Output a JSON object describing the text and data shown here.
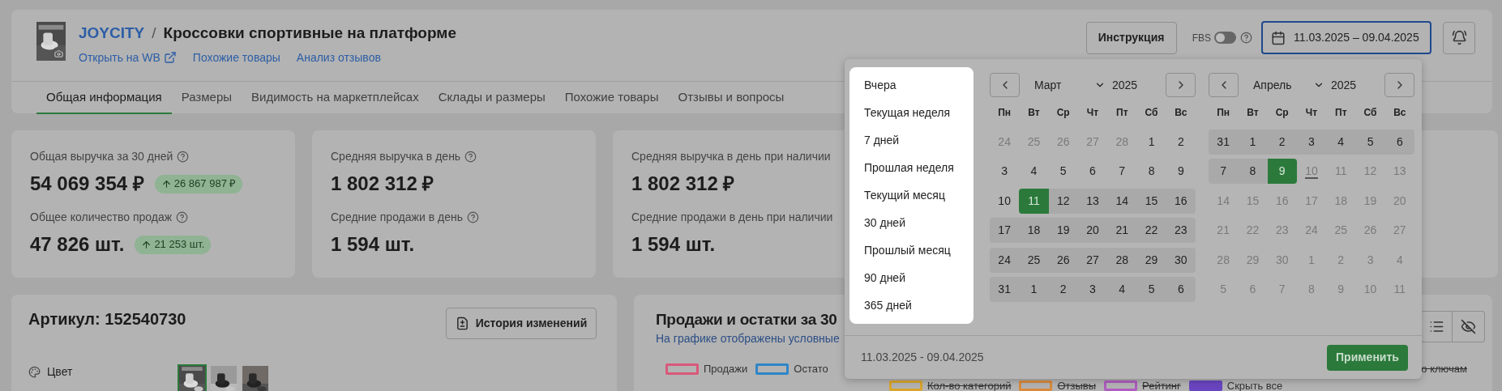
{
  "header": {
    "brand": "JOYCITY",
    "separator": "/",
    "title": "Кроссовки спортивные на платформе",
    "links": [
      {
        "label": "Открыть на WB",
        "external": true
      },
      {
        "label": "Похожие товары",
        "external": false
      },
      {
        "label": "Анализ отзывов",
        "external": false
      }
    ],
    "instruction_button": "Инструкция",
    "fbs": {
      "label": "FBS",
      "on": false
    },
    "date_range": "11.03.2025 – 09.04.2025"
  },
  "tabs": [
    {
      "label": "Общая информация",
      "selected": true
    },
    {
      "label": "Размеры",
      "selected": false
    },
    {
      "label": "Видимость на маркетплейсах",
      "selected": false
    },
    {
      "label": "Склады и размеры",
      "selected": false
    },
    {
      "label": "Похожие товары",
      "selected": false
    },
    {
      "label": "Отзывы и вопросы",
      "selected": false
    }
  ],
  "stats": [
    {
      "rows": [
        {
          "label": "Общая выручка за 30 дней",
          "help": true,
          "value": "54 069 354 ₽",
          "delta": "26 867 987 ₽"
        },
        {
          "label": "Общее количество продаж",
          "help": true,
          "value": "47 826 шт.",
          "delta": "21 253 шт."
        }
      ]
    },
    {
      "rows": [
        {
          "label": "Средняя выручка в день",
          "help": true,
          "value": "1 802 312 ₽"
        },
        {
          "label": "Средние продажи в день",
          "help": true,
          "value": "1 594 шт."
        }
      ]
    },
    {
      "rows": [
        {
          "label": "Средняя выручка в день при наличии",
          "help": false,
          "value": "1 802 312 ₽"
        },
        {
          "label": "Средние продажи в день при наличии",
          "help": false,
          "value": "1 594 шт."
        }
      ]
    }
  ],
  "product": {
    "article": "Артикул: 152540730",
    "history_button": "История изменений",
    "color_label": "Цвет",
    "thumbnails": [
      {
        "kind": "picture",
        "selected": true
      },
      {
        "kind": "picture",
        "selected": false
      },
      {
        "kind": "picture",
        "selected": false
      }
    ]
  },
  "chart": {
    "title": "Продажи и остатки за 30",
    "subtitle": "На графике отображены условные",
    "legend": [
      {
        "label": "Продажи",
        "color": "#d9587a",
        "hidden": false
      },
      {
        "label": "Остато",
        "color": "#2f86c8",
        "hidden": false
      }
    ],
    "legend_right": {
      "label": "о ключам",
      "hidden": true
    },
    "legend2": [
      {
        "label": "Кол-во категорий",
        "color": "#d9a52c",
        "hidden": true,
        "filled": false
      },
      {
        "label": "Отзывы",
        "color": "#d98a3c",
        "hidden": true,
        "filled": false
      },
      {
        "label": "Рейтинг",
        "color": "#b05cc0",
        "hidden": true,
        "filled": false
      },
      {
        "label": "Скрыть все",
        "color": "#6a45c0",
        "hidden": false,
        "filled": true
      }
    ]
  },
  "datepicker": {
    "presets": [
      {
        "label": "Вчера",
        "selected": false
      },
      {
        "label": "Текущая неделя",
        "selected": false
      },
      {
        "label": "7 дней",
        "selected": false
      },
      {
        "label": "Прошлая неделя",
        "selected": false
      },
      {
        "label": "Текущий месяц",
        "selected": false
      },
      {
        "label": "30 дней",
        "selected": false
      },
      {
        "label": "Прошлый месяц",
        "selected": false
      },
      {
        "label": "90 дней",
        "selected": false
      },
      {
        "label": "365 дней",
        "selected": false
      }
    ],
    "months": [
      {
        "month": "Март",
        "year": "2025",
        "weekdays": [
          "Пн",
          "Вт",
          "Ср",
          "Чт",
          "Пт",
          "Сб",
          "Вс"
        ],
        "weeks": [
          [
            {
              "d": "24",
              "kind": "outside"
            },
            {
              "d": "25",
              "kind": "outside"
            },
            {
              "d": "26",
              "kind": "outside"
            },
            {
              "d": "27",
              "kind": "outside"
            },
            {
              "d": "28",
              "kind": "outside"
            },
            {
              "d": "1",
              "kind": "day"
            },
            {
              "d": "2",
              "kind": "day"
            }
          ],
          [
            {
              "d": "3",
              "kind": "day"
            },
            {
              "d": "4",
              "kind": "day"
            },
            {
              "d": "5",
              "kind": "day"
            },
            {
              "d": "6",
              "kind": "day"
            },
            {
              "d": "7",
              "kind": "day"
            },
            {
              "d": "8",
              "kind": "day"
            },
            {
              "d": "9",
              "kind": "day"
            }
          ],
          [
            {
              "d": "10",
              "kind": "day"
            },
            {
              "d": "11",
              "kind": "start"
            },
            {
              "d": "12",
              "kind": "range"
            },
            {
              "d": "13",
              "kind": "range"
            },
            {
              "d": "14",
              "kind": "range"
            },
            {
              "d": "15",
              "kind": "range"
            },
            {
              "d": "16",
              "kind": "range"
            }
          ],
          [
            {
              "d": "17",
              "kind": "range"
            },
            {
              "d": "18",
              "kind": "range"
            },
            {
              "d": "19",
              "kind": "range"
            },
            {
              "d": "20",
              "kind": "range"
            },
            {
              "d": "21",
              "kind": "range"
            },
            {
              "d": "22",
              "kind": "range"
            },
            {
              "d": "23",
              "kind": "range"
            }
          ],
          [
            {
              "d": "24",
              "kind": "range"
            },
            {
              "d": "25",
              "kind": "range"
            },
            {
              "d": "26",
              "kind": "range"
            },
            {
              "d": "27",
              "kind": "range"
            },
            {
              "d": "28",
              "kind": "range"
            },
            {
              "d": "29",
              "kind": "range"
            },
            {
              "d": "30",
              "kind": "range"
            }
          ],
          [
            {
              "d": "31",
              "kind": "range"
            },
            {
              "d": "1",
              "kind": "range"
            },
            {
              "d": "2",
              "kind": "range"
            },
            {
              "d": "3",
              "kind": "range"
            },
            {
              "d": "4",
              "kind": "range"
            },
            {
              "d": "5",
              "kind": "range"
            },
            {
              "d": "6",
              "kind": "range"
            }
          ]
        ]
      },
      {
        "month": "Апрель",
        "year": "2025",
        "weekdays": [
          "Пн",
          "Вт",
          "Ср",
          "Чт",
          "Пт",
          "Сб",
          "Вс"
        ],
        "weeks": [
          [
            {
              "d": "31",
              "kind": "range"
            },
            {
              "d": "1",
              "kind": "range"
            },
            {
              "d": "2",
              "kind": "range"
            },
            {
              "d": "3",
              "kind": "range"
            },
            {
              "d": "4",
              "kind": "range"
            },
            {
              "d": "5",
              "kind": "range"
            },
            {
              "d": "6",
              "kind": "range"
            }
          ],
          [
            {
              "d": "7",
              "kind": "range"
            },
            {
              "d": "8",
              "kind": "range"
            },
            {
              "d": "9",
              "kind": "end"
            },
            {
              "d": "10",
              "kind": "today"
            },
            {
              "d": "11",
              "kind": "disabled"
            },
            {
              "d": "12",
              "kind": "disabled"
            },
            {
              "d": "13",
              "kind": "disabled"
            }
          ],
          [
            {
              "d": "14",
              "kind": "disabled"
            },
            {
              "d": "15",
              "kind": "disabled"
            },
            {
              "d": "16",
              "kind": "disabled"
            },
            {
              "d": "17",
              "kind": "disabled"
            },
            {
              "d": "18",
              "kind": "disabled"
            },
            {
              "d": "19",
              "kind": "disabled"
            },
            {
              "d": "20",
              "kind": "disabled"
            }
          ],
          [
            {
              "d": "21",
              "kind": "disabled"
            },
            {
              "d": "22",
              "kind": "disabled"
            },
            {
              "d": "23",
              "kind": "disabled"
            },
            {
              "d": "24",
              "kind": "disabled"
            },
            {
              "d": "25",
              "kind": "disabled"
            },
            {
              "d": "26",
              "kind": "disabled"
            },
            {
              "d": "27",
              "kind": "disabled"
            }
          ],
          [
            {
              "d": "28",
              "kind": "disabled"
            },
            {
              "d": "29",
              "kind": "disabled"
            },
            {
              "d": "30",
              "kind": "disabled"
            },
            {
              "d": "1",
              "kind": "disabled"
            },
            {
              "d": "2",
              "kind": "disabled"
            },
            {
              "d": "3",
              "kind": "disabled"
            },
            {
              "d": "4",
              "kind": "disabled"
            }
          ],
          [
            {
              "d": "5",
              "kind": "disabled"
            },
            {
              "d": "6",
              "kind": "disabled"
            },
            {
              "d": "7",
              "kind": "disabled"
            },
            {
              "d": "8",
              "kind": "disabled"
            },
            {
              "d": "9",
              "kind": "disabled"
            },
            {
              "d": "10",
              "kind": "disabled"
            },
            {
              "d": "11",
              "kind": "disabled"
            }
          ]
        ]
      }
    ],
    "summary": "11.03.2025 - 09.04.2025",
    "apply": "Применить"
  }
}
